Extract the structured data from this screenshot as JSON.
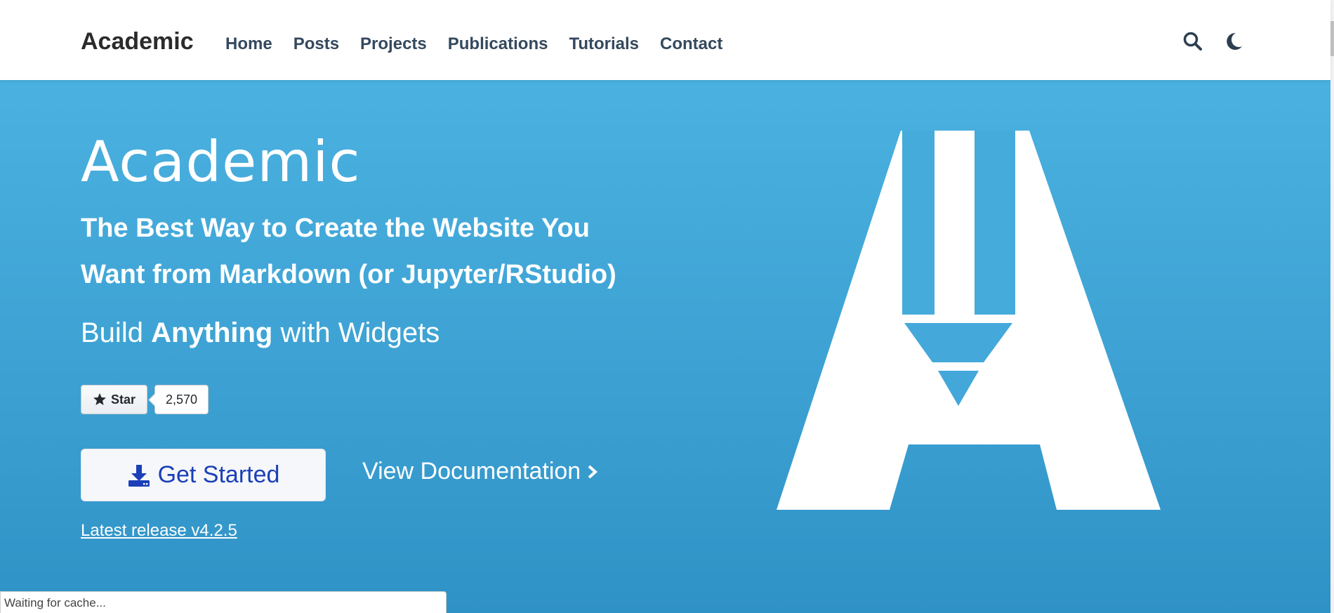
{
  "navbar": {
    "brand": "Academic",
    "links": [
      "Home",
      "Posts",
      "Projects",
      "Publications",
      "Tutorials",
      "Contact"
    ],
    "icons": [
      "search-icon",
      "moon-icon"
    ]
  },
  "hero": {
    "title": "Academic",
    "subtitle": "The Best Way to Create the Website You Want from Markdown (or Jupyter/RStudio)",
    "tagline": {
      "before": "Build ",
      "bold": "Anything",
      "after": " with Widgets"
    },
    "github": {
      "star_label": "Star",
      "star_count": "2,570"
    },
    "primary_button": "Get Started",
    "docs_link": "View Documentation",
    "release_link": "Latest release v4.2.5"
  },
  "status_bar": {
    "text": "Waiting for cache..."
  },
  "colors": {
    "hero_top": "#4ab1e0",
    "hero_bottom": "#2f92c6",
    "nav_text": "#34495e",
    "button_text": "#1b3fb8"
  }
}
